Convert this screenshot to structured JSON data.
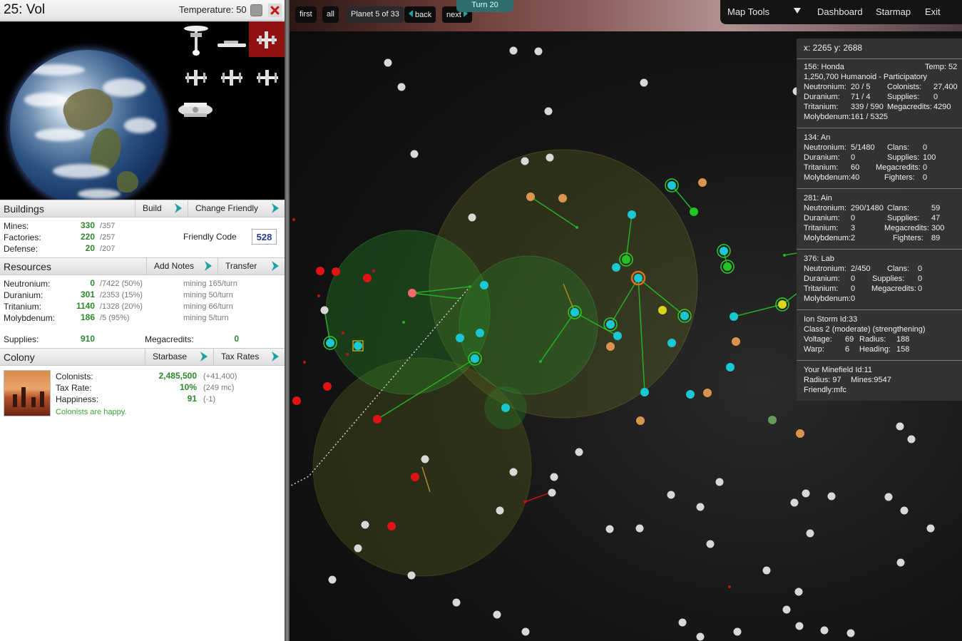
{
  "left_panel": {
    "title": "25: Vol",
    "temperature": "Temperature: 50",
    "buildings": {
      "header": "Buildings",
      "build_btn": "Build",
      "change_friendly_btn": "Change Friendly",
      "rows": [
        {
          "label": "Mines:",
          "value": "330",
          "max": "/357"
        },
        {
          "label": "Factories:",
          "value": "220",
          "max": "/257"
        },
        {
          "label": "Defense:",
          "value": "20",
          "max": "/207"
        }
      ],
      "friendly_code_label": "Friendly Code",
      "friendly_code": "528"
    },
    "resources": {
      "header": "Resources",
      "add_notes_btn": "Add Notes",
      "transfer_btn": "Transfer",
      "rows": [
        {
          "label": "Neutronium:",
          "value": "0",
          "ground": "/7422 (50%)",
          "mining": "mining 165/turn"
        },
        {
          "label": "Duranium:",
          "value": "301",
          "ground": "/2353 (15%)",
          "mining": "mining 50/turn"
        },
        {
          "label": "Tritanium:",
          "value": "1140",
          "ground": "/1328 (20%)",
          "mining": "mining 66/turn"
        },
        {
          "label": "Molybdenum:",
          "value": "186",
          "ground": "/5 (95%)",
          "mining": "mining 5/turn"
        }
      ],
      "supplies_label": "Supplies:",
      "supplies": "910",
      "megacredits_label": "Megacredits:",
      "megacredits": "0"
    },
    "colony": {
      "header": "Colony",
      "starbase_btn": "Starbase",
      "tax_rates_btn": "Tax Rates",
      "colonists_label": "Colonists:",
      "colonists": "2,485,500",
      "colonists_delta": "(+41,400)",
      "tax_label": "Tax Rate:",
      "tax": "10%",
      "tax_mc": "(249 mc)",
      "happiness_label": "Happiness:",
      "happiness": "91",
      "happiness_delta": "(-1)",
      "message": "Colonists are happy."
    }
  },
  "nav": {
    "first": "first",
    "all": "all",
    "planet_counter": "Planet 5 of 33",
    "back": "back",
    "next": "next",
    "turn": "Turn 20"
  },
  "menu": {
    "map_tools": "Map Tools",
    "dashboard": "Dashboard",
    "starmap": "Starmap",
    "exit": "Exit"
  },
  "info_panel": {
    "coords": "x: 2265 y: 2688",
    "honda": {
      "name": "156: Honda",
      "temp": "Temp: 52",
      "pop": "1,250,700 Humanoid - Participatory",
      "neu_label": "Neutronium:",
      "neu": "20 / 5",
      "col_label": "Colonists:",
      "col": "27,400",
      "dur_label": "Duranium:",
      "dur": "71 / 4",
      "sup_label": "Supplies:",
      "sup": "0",
      "tri_label": "Tritanium:",
      "tri": "339 / 590",
      "mc_label": "Megacredits:",
      "mc": "4290",
      "mol_label": "Molybdenum:",
      "mol": "161 / 5325"
    },
    "an": {
      "name": "134: An",
      "neu_label": "Neutronium:",
      "neu": "5/1480",
      "clans_label": "Clans:",
      "clans": "0",
      "dur_label": "Duranium:",
      "dur": "0",
      "sup_label": "Supplies:",
      "sup": "100",
      "tri_label": "Tritanium:",
      "tri": "60",
      "mc_label": "Megacredits:",
      "mc": "0",
      "mol_label": "Molybdenum:",
      "mol": "40",
      "fig_label": "Fighters:",
      "fig": "0"
    },
    "ain": {
      "name": "281: Ain",
      "neu_label": "Neutronium:",
      "neu": "290/1480",
      "clans_label": "Clans:",
      "clans": "59",
      "dur_label": "Duranium:",
      "dur": "0",
      "sup_label": "Supplies:",
      "sup": "47",
      "tri_label": "Tritanium:",
      "tri": "3",
      "mc_label": "Megacredits:",
      "mc": "300",
      "mol_label": "Molybdenum:",
      "mol": "2",
      "fig_label": "Fighters:",
      "fig": "89"
    },
    "lab": {
      "name": "376: Lab",
      "neu_label": "Neutronium:",
      "neu": "2/450",
      "clans_label": "Clans:",
      "clans": "0",
      "dur_label": "Duranium:",
      "dur": "0",
      "sup_label": "Supplies:",
      "sup": "0",
      "tri_label": "Tritanium:",
      "tri": "0",
      "mc_label": "Megacredits:",
      "mc": "0",
      "mol_label": "Molybdenum:",
      "mol": "0"
    },
    "storm": {
      "name": "Ion Storm Id:33",
      "class": "Class 2 (moderate) (strengthening)",
      "volt_label": "Voltage:",
      "volt": "69",
      "rad_label": "Radius:",
      "rad": "188",
      "warp_label": "Warp:",
      "warp": "6",
      "head_label": "Heading:",
      "head": "158"
    },
    "minefield": {
      "name": "Your Minefield Id:11",
      "radius": "Radius:  97",
      "mines": "Mines:9547",
      "friendly": "Friendly:mfc"
    }
  },
  "colors": {
    "resource_value": "#2b8a2b",
    "accent_teal": "#1fa3a6",
    "own_planet": "#19c8d2",
    "enemy_planet": "#e01414",
    "neutral_planet": "#d8d8d8",
    "ally_planet": "#d9944f"
  }
}
